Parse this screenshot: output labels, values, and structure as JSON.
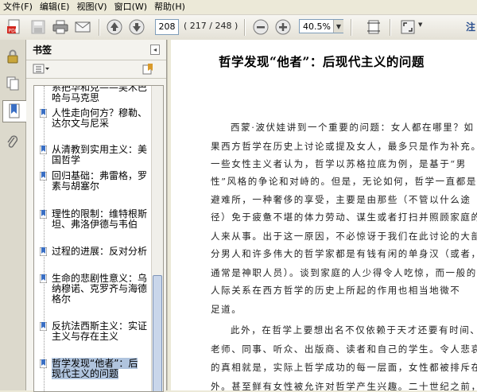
{
  "menu": {
    "file": "文件(F)",
    "edit": "编辑(E)",
    "view": "视图(V)",
    "window": "窗口(W)",
    "help": "帮助(H)"
  },
  "toolbar": {
    "page_input": "208",
    "page_count": "( 217 / 248 )",
    "zoom": "40.5%",
    "right_label": "注"
  },
  "panel": {
    "title": "书签"
  },
  "bookmarks": [
    "系把华和克——吴木巴哈与马克思",
    "人性走向何方？穆勒、达尔文与尼采",
    "从清教到实用主义：美国哲学",
    "回归基础：弗雷格，罗素与胡塞尔",
    "理性的限制：维特根斯坦、弗洛伊德与韦伯",
    "过程的进展：反对分析",
    "生命的悲剧性意义：乌纳穆诺、克罗齐与海德格尔",
    "反抗法西斯主义：实证主义与存在主义",
    "哲学发现“他者”：后现代主义的问题"
  ],
  "document": {
    "title": "哲学发现“他者”：后现代主义的问题",
    "lines": [
      "西蒙·波伏娃讲到一个重要的问题：女人都在哪里？如",
      "果西方哲学在历史上讨论或提及女人，最多只是作为补充。",
      "一些女性主义者认为，哲学以苏格拉底为例，是基于“男",
      "性”风格的争论和对峙的。但是，无论如何，哲学一直都是",
      "避难所，一种奢侈的享受，主要是由那些（不管以什么途",
      "径）免于疲惫不堪的体力劳动、谋生或者打扫并照顾家庭的",
      "人来从事。出于这一原因，不必惊讶于我们在此讨论的大部",
      "分男人和许多伟大的哲学家都是有钱有闲的单身汉（或者，",
      "通常是神职人员）。谈到家庭的人少得令人吃惊，而一般的",
      "人际关系在西方哲学的历史上所起的作用也相当地微不",
      "足道。",
      "此外，在哲学上要想出名不仅依赖于天才还要有时间、",
      "老师、同事、听众、出版商、读者和自己的学生。令人悲哀",
      "的真相就是，实际上哲学成功的每一层面，女性都被排斥在",
      "外。甚至鲜有女性被允许对哲学产生兴趣。二十世纪之前，"
    ]
  },
  "colors": {
    "selection": "#b0c4de",
    "chrome": "#ece9d8"
  }
}
